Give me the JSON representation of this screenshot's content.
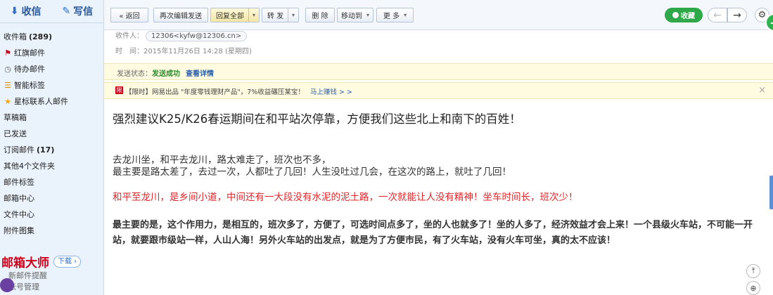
{
  "sidebar": {
    "receive_label": "收信",
    "compose_label": "写信",
    "items": [
      {
        "label": "收件箱",
        "count": "(289)",
        "icon": "none"
      },
      {
        "label": "红旗邮件",
        "count": "",
        "icon": "flag-icon"
      },
      {
        "label": "待办邮件",
        "count": "",
        "icon": "clock-icon"
      },
      {
        "label": "智能标签",
        "count": "",
        "icon": "tag-icon"
      },
      {
        "label": "星标联系人邮件",
        "count": "",
        "icon": "star-icon"
      },
      {
        "label": "草稿箱",
        "count": "",
        "icon": "none"
      },
      {
        "label": "已发送",
        "count": "",
        "icon": "none"
      },
      {
        "label": "订阅邮件",
        "count": "(17)",
        "icon": "none"
      },
      {
        "label": "其他4个文件夹",
        "count": "",
        "icon": "none"
      },
      {
        "label": "邮件标签",
        "count": "",
        "icon": "none"
      },
      {
        "label": "邮箱中心",
        "count": "",
        "icon": "none"
      },
      {
        "label": "文件中心",
        "count": "",
        "icon": "none"
      },
      {
        "label": "附件图集",
        "count": "",
        "icon": "none"
      }
    ],
    "promo": {
      "brand": "邮箱大师",
      "download": "下载",
      "line1": "新邮件提醒",
      "line2": "帐号管理"
    }
  },
  "toolbar": {
    "back": "« 返回",
    "reedit": "再次编辑发送",
    "reply_all": "回复全部",
    "forward": "转 发",
    "delete": "删 除",
    "move_to": "移动到",
    "more": "更 多",
    "favorite": "收藏"
  },
  "meta": {
    "recipient_label": "收件人：",
    "recipient": "12306<kyfw@12306.cn>",
    "time_label": "时　间：",
    "time": "2015年11月26日 14:28 (星期四)"
  },
  "status": {
    "label": "发送状态：",
    "value": "发送成功",
    "link": "查看详情"
  },
  "ad": {
    "badge": "限",
    "text": "【限时】网易出品 \"年度零钱理财产品\"，7%收益碾压某宝！",
    "link": "马上赚钱 > >"
  },
  "mail": {
    "subject": "强烈建议K25/K26春运期间在和平站次停靠，方便我们这些北上和南下的百姓！",
    "para1_line1": "去龙川坐，和平去龙川，路太难走了，班次也不多，",
    "para1_line2": "最主要是路太差了，去过一次，人都吐了几回！人生没吐过几会，在这次的路上，就吐了几回！",
    "para2": "和平至龙川，是乡间小道，中间还有一大段没有水泥的泥土路，一次就能让人没有精神！坐车时间长，班次少！",
    "para3": "最主要的是，这个作用力，是相互的，班次多了，方便了，可选时间点多了，坐的人也就多了！坐的人多了，经济效益才会上来！一个县级火车站，不可能一开站，就要跟市级站一样，人山人海！另外火车站的出发点，就是为了方便市民，有了火车站，没有火车可坐，真的太不应该！"
  },
  "colors": {
    "accent": "#2a6fc9",
    "favorite_green": "#2fa84a",
    "warning_red": "#e0262a"
  }
}
